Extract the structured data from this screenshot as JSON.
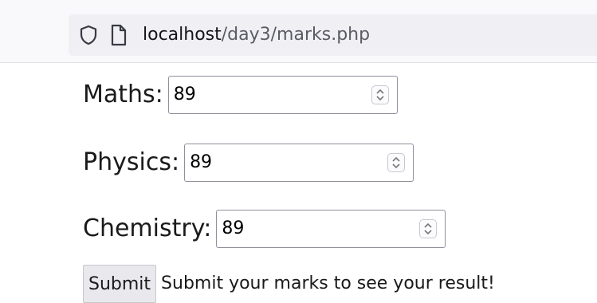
{
  "browser": {
    "url_host": "localhost",
    "url_path": "/day3/marks.php"
  },
  "form": {
    "fields": [
      {
        "label": "Maths:",
        "value": "89"
      },
      {
        "label": "Physics:",
        "value": "89"
      },
      {
        "label": "Chemistry:",
        "value": "89"
      }
    ],
    "submit_label": "Submit",
    "message": "Submit your marks to see your result!"
  },
  "icons": {
    "tracking": "shield-icon",
    "page": "page-icon",
    "spinner": "spinner-icon"
  }
}
